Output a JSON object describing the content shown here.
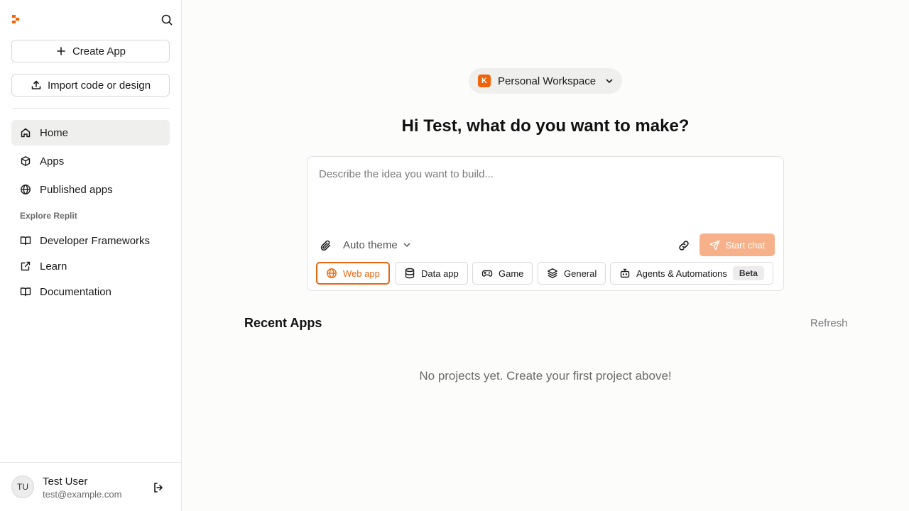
{
  "sidebar": {
    "create_app_label": "Create App",
    "import_label": "Import code or design",
    "nav": [
      {
        "label": "Home",
        "icon": "home-icon",
        "active": true
      },
      {
        "label": "Apps",
        "icon": "package-icon"
      },
      {
        "label": "Published apps",
        "icon": "globe-icon"
      }
    ],
    "explore_label": "Explore Replit",
    "explore": [
      {
        "label": "Developer Frameworks",
        "icon": "book-icon"
      },
      {
        "label": "Learn",
        "icon": "external-link-icon"
      },
      {
        "label": "Documentation",
        "icon": "book-icon"
      }
    ],
    "user": {
      "initials": "TU",
      "name": "Test User",
      "email": "test@example.com"
    }
  },
  "main": {
    "workspace": {
      "badge": "K",
      "label": "Personal Workspace"
    },
    "greeting": "Hi Test, what do you want to make?",
    "composer": {
      "placeholder": "Describe the idea you want to build...",
      "theme_label": "Auto theme",
      "start_label": "Start chat"
    },
    "chips": [
      {
        "label": "Web app",
        "icon": "globe-icon",
        "selected": true
      },
      {
        "label": "Data app",
        "icon": "database-icon"
      },
      {
        "label": "Game",
        "icon": "gamepad-icon"
      },
      {
        "label": "General",
        "icon": "layers-icon"
      },
      {
        "label": "Agents & Automations",
        "icon": "bot-icon",
        "badge": "Beta"
      }
    ],
    "recent_title": "Recent Apps",
    "refresh_label": "Refresh",
    "empty_message": "No projects yet. Create your first project above!"
  },
  "colors": {
    "accent": "#f26207",
    "start_button": "#f7b18a",
    "selected_chip": "#e8650f"
  }
}
